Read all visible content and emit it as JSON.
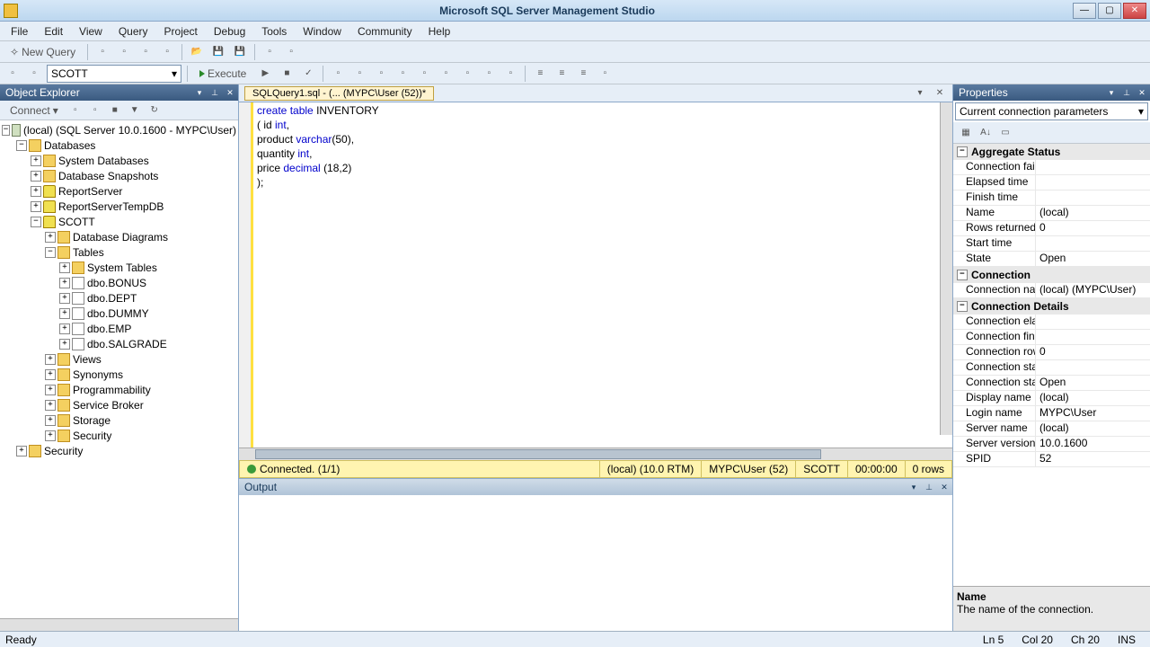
{
  "title": "Microsoft SQL Server Management Studio",
  "menu": [
    "File",
    "Edit",
    "View",
    "Query",
    "Project",
    "Debug",
    "Tools",
    "Window",
    "Community",
    "Help"
  ],
  "toolbar1": {
    "newquery": "New Query"
  },
  "toolbar2": {
    "database": "SCOTT",
    "execute": "Execute"
  },
  "oe": {
    "title": "Object Explorer",
    "connect": "Connect",
    "root": "(local) (SQL Server 10.0.1600 - MYPC\\User)",
    "nodes": {
      "databases": "Databases",
      "sysdb": "System Databases",
      "snap": "Database Snapshots",
      "rs": "ReportServer",
      "rstmp": "ReportServerTempDB",
      "scott": "SCOTT",
      "diagrams": "Database Diagrams",
      "tables": "Tables",
      "systables": "System Tables",
      "t_bonus": "dbo.BONUS",
      "t_dept": "dbo.DEPT",
      "t_dummy": "dbo.DUMMY",
      "t_emp": "dbo.EMP",
      "t_salgrade": "dbo.SALGRADE",
      "views": "Views",
      "synonyms": "Synonyms",
      "prog": "Programmability",
      "svcbroker": "Service Broker",
      "storage": "Storage",
      "security_db": "Security",
      "security_srv": "Security"
    }
  },
  "query": {
    "tab": "SQLQuery1.sql - (... (MYPC\\User (52))*",
    "l1a": "create",
    "l1b": "table",
    "l1c": "INVENTORY",
    "l2a": "( id",
    "l2b": "int",
    "l2c": ",",
    "l3a": "product",
    "l3b": "varchar",
    "l3c": "(50),",
    "l4a": "quantity",
    "l4b": "int",
    "l4c": ",",
    "l5a": "price",
    "l5b": "decimal",
    "l5c": "(18,2)",
    "l6": ");"
  },
  "qstatus": {
    "conn": "Connected. (1/1)",
    "server": "(local) (10.0 RTM)",
    "user": "MYPC\\User (52)",
    "db": "SCOTT",
    "time": "00:00:00",
    "rows": "0 rows"
  },
  "output": {
    "title": "Output"
  },
  "props": {
    "title": "Properties",
    "selector": "Current connection parameters",
    "cat_agg": "Aggregate Status",
    "cat_conn": "Connection",
    "cat_det": "Connection Details",
    "rows": {
      "connfail": {
        "k": "Connection failur",
        "v": ""
      },
      "elapsed": {
        "k": "Elapsed time",
        "v": ""
      },
      "finish": {
        "k": "Finish time",
        "v": ""
      },
      "name": {
        "k": "Name",
        "v": "(local)"
      },
      "rowsret": {
        "k": "Rows returned",
        "v": "0"
      },
      "start": {
        "k": "Start time",
        "v": ""
      },
      "state": {
        "k": "State",
        "v": "Open"
      },
      "connname": {
        "k": "Connection name",
        "v": "(local) (MYPC\\User)"
      },
      "connelaps": {
        "k": "Connection elaps",
        "v": ""
      },
      "connfinish": {
        "k": "Connection finish",
        "v": ""
      },
      "connrows": {
        "k": "Connection rows",
        "v": "0"
      },
      "connstart": {
        "k": "Connection start t",
        "v": ""
      },
      "connstate": {
        "k": "Connection state",
        "v": "Open"
      },
      "dispname": {
        "k": "Display name",
        "v": "(local)"
      },
      "login": {
        "k": "Login name",
        "v": "MYPC\\User"
      },
      "srvname": {
        "k": "Server name",
        "v": "(local)"
      },
      "srvver": {
        "k": "Server version",
        "v": "10.0.1600"
      },
      "spid": {
        "k": "SPID",
        "v": "52"
      }
    },
    "desc_title": "Name",
    "desc_text": "The name of the connection."
  },
  "status": {
    "ready": "Ready",
    "ln": "Ln 5",
    "col": "Col 20",
    "ch": "Ch 20",
    "ins": "INS"
  }
}
